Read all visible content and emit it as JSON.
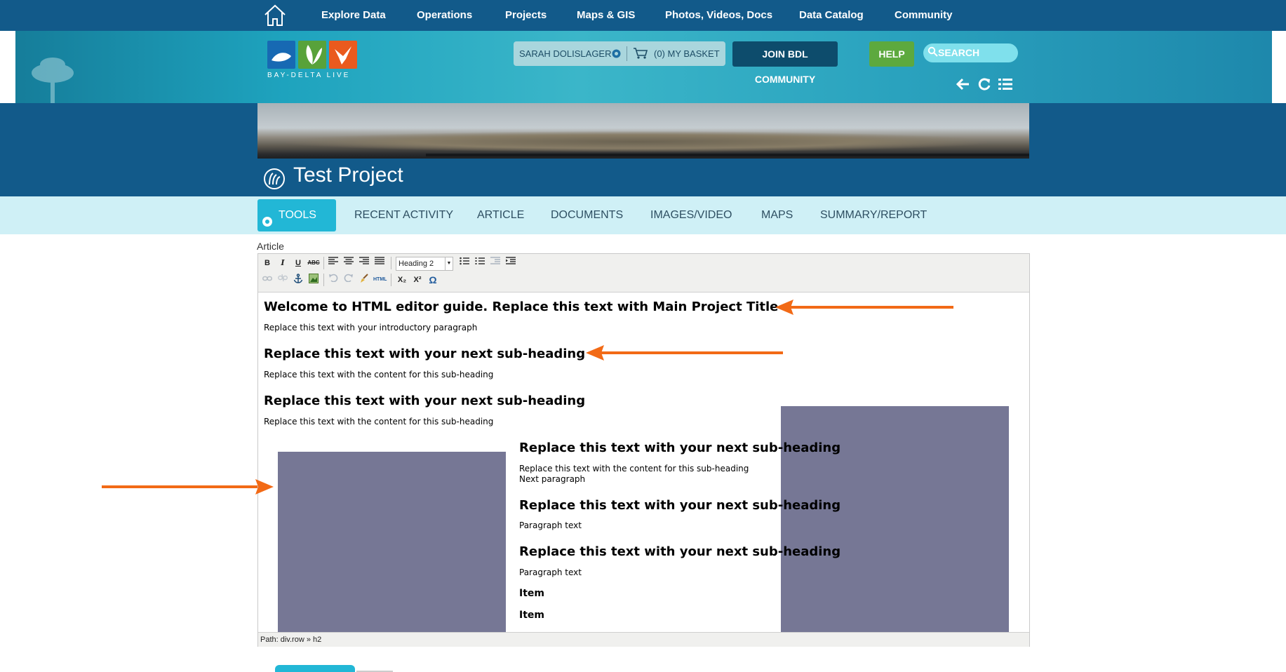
{
  "topnav": {
    "items": [
      "Explore Data",
      "Operations",
      "Projects",
      "Maps & GIS",
      "Photos, Videos, Docs",
      "Data Catalog",
      "Community"
    ]
  },
  "header": {
    "logo_caption": "BAY-DELTA LIVE",
    "user_name": "SARAH DOLISLAGER",
    "basket_label": "(0) MY BASKET",
    "join_label": "JOIN BDL COMMUNITY",
    "help_label": "HELP",
    "search_label": "SEARCH"
  },
  "project": {
    "title": "Test Project"
  },
  "tabs": [
    "TOOLS",
    "RECENT ACTIVITY",
    "ARTICLE",
    "DOCUMENTS",
    "IMAGES/VIDEO",
    "MAPS",
    "SUMMARY/REPORT"
  ],
  "editor": {
    "label": "Article",
    "format_selected": "Heading 2",
    "toolbar": {
      "bold": "B",
      "italic": "I",
      "underline": "U",
      "strike": "ABC",
      "html": "HTML",
      "sub": "X₂",
      "sup": "X²",
      "omega": "Ω"
    },
    "content": {
      "main_title": "Welcome to HTML editor guide. Replace this text with Main Project Title",
      "intro": "Replace this text with your introductory paragraph",
      "subheading": "Replace this text with your next sub-heading",
      "sub_content": "Replace this text with the content for this sub-heading",
      "next_paragraph": "Next paragraph",
      "paragraph_text": "Paragraph text",
      "item": "Item"
    },
    "path": "Path: div.row » h2"
  },
  "colors": {
    "nav_bg": "#125a8a",
    "tab_active": "#22b7d6",
    "help_green": "#5da93e",
    "image_placeholder": "#767795",
    "annotation_arrow": "#f26a16"
  }
}
